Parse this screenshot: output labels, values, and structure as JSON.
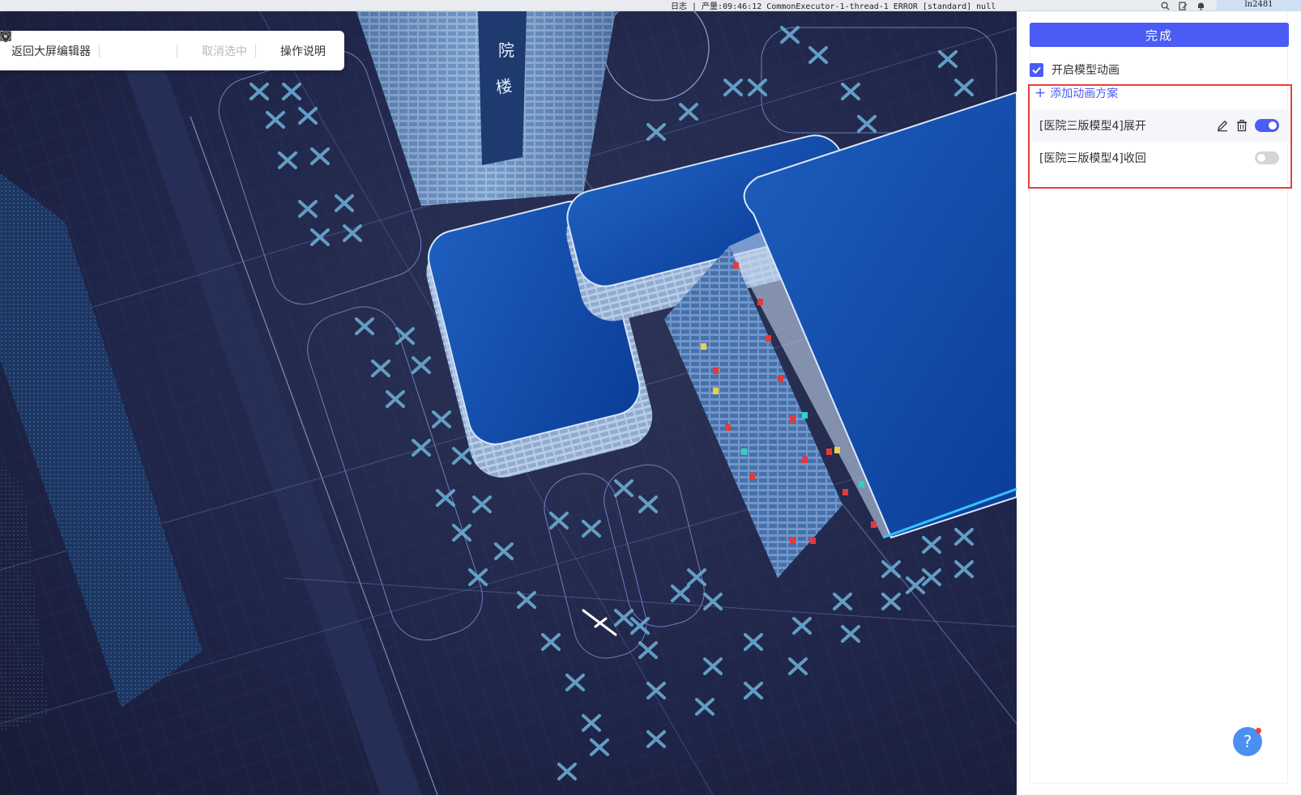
{
  "topbar": {
    "log_text": "日志 | 产量:09:46:12 CommonExecutor-1-thread-1 ERROR [standard] null",
    "user_label": "ln2481",
    "icons": [
      "search-icon",
      "edit-doc-icon",
      "bell-icon"
    ]
  },
  "toolbar": {
    "back_label": "返回大屏编辑器",
    "view_icons": [
      "cube-front-icon",
      "cube-solid-icon",
      "cube-side-icon"
    ],
    "deselect_label": "取消选中",
    "help_label": "操作说明"
  },
  "scene": {
    "building_signage": [
      "院",
      "楼"
    ]
  },
  "panel": {
    "done_label": "完成",
    "enable_animation_label": "开启模型动画",
    "enable_animation_checked": true,
    "add_scheme_label": "添加动画方案",
    "schemes": [
      {
        "label": "[医院三版模型4]展开",
        "enabled": true
      },
      {
        "label": "[医院三版模型4]收回",
        "enabled": false
      }
    ],
    "accent_color": "#4a5cf3",
    "highlight_color": "#e8403d"
  },
  "help_button": {
    "label": "?"
  }
}
